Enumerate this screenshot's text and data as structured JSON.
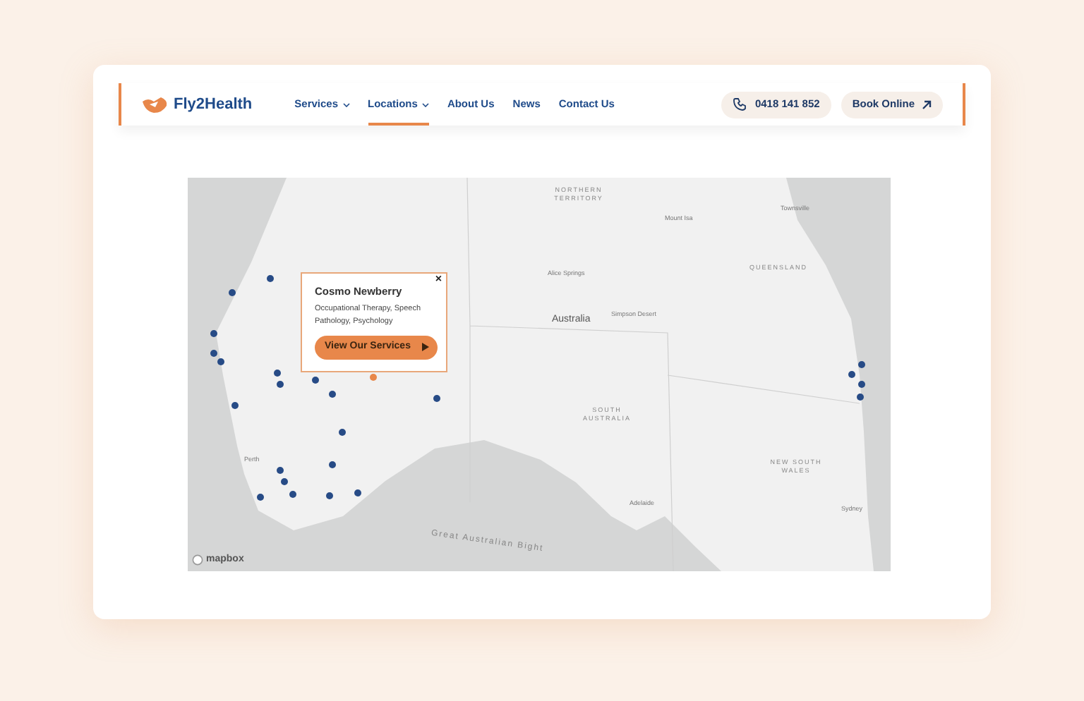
{
  "header": {
    "logo": "Fly2Health",
    "nav": [
      {
        "label": "Services",
        "dropdown": true,
        "selected": false
      },
      {
        "label": "Locations",
        "dropdown": true,
        "selected": true
      },
      {
        "label": "About Us",
        "dropdown": false,
        "selected": false
      },
      {
        "label": "News",
        "dropdown": false,
        "selected": false
      },
      {
        "label": "Contact Us",
        "dropdown": false,
        "selected": false
      }
    ],
    "phone": "0418 141 852",
    "book_button": "Book Online"
  },
  "map": {
    "labels": [
      {
        "text": "NORTHERN TERRITORY",
        "kind": "region"
      },
      {
        "text": "Mount Isa",
        "kind": "city"
      },
      {
        "text": "Townsville",
        "kind": "city"
      },
      {
        "text": "Alice Springs",
        "kind": "city"
      },
      {
        "text": "QUEENSLAND",
        "kind": "region"
      },
      {
        "text": "Simpson Desert",
        "kind": "city"
      },
      {
        "text": "Australia",
        "kind": "country"
      },
      {
        "text": "SOUTH AUSTRALIA",
        "kind": "region"
      },
      {
        "text": "NEW SOUTH WALES",
        "kind": "region"
      },
      {
        "text": "Adelaide",
        "kind": "city"
      },
      {
        "text": "Sydney",
        "kind": "city"
      },
      {
        "text": "Perth",
        "kind": "city"
      },
      {
        "text": "Great Australian Bight",
        "kind": "sea"
      }
    ],
    "pins": [
      {
        "selected": false
      },
      {
        "selected": false
      },
      {
        "selected": false
      },
      {
        "selected": false
      },
      {
        "selected": false
      },
      {
        "selected": false
      },
      {
        "selected": false
      },
      {
        "selected": false
      },
      {
        "selected": false
      },
      {
        "selected": false
      },
      {
        "selected": false
      },
      {
        "selected": false
      },
      {
        "selected": false
      },
      {
        "selected": false
      },
      {
        "selected": false
      },
      {
        "selected": false
      },
      {
        "selected": false
      },
      {
        "selected": false
      },
      {
        "selected": false
      },
      {
        "selected": false
      },
      {
        "selected": false
      },
      {
        "selected": false
      },
      {
        "selected": false
      },
      {
        "selected": true
      }
    ],
    "popup": {
      "title": "Cosmo Newberry",
      "services": "Occupational Therapy, Speech Pathology, Psychology",
      "button": "View Our Services",
      "close": "×"
    },
    "attribution": "mapbox"
  }
}
